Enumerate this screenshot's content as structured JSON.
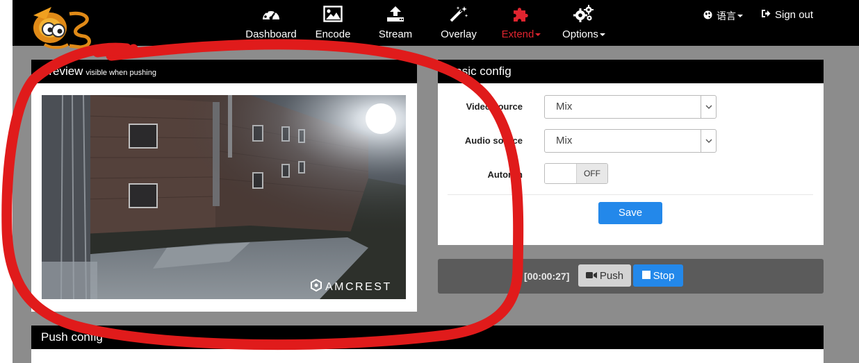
{
  "nav": [
    {
      "label": "Dashboard",
      "icon": "dashboard-icon"
    },
    {
      "label": "Encode",
      "icon": "image-icon"
    },
    {
      "label": "Stream",
      "icon": "upload-icon"
    },
    {
      "label": "Overlay",
      "icon": "magic-wand-icon"
    },
    {
      "label": "Extend",
      "icon": "puzzle-icon",
      "active": true,
      "dropdown": true
    },
    {
      "label": "Options",
      "icon": "gears-icon",
      "dropdown": true
    }
  ],
  "language": {
    "label": "语言",
    "icon": "globe-icon"
  },
  "signout": {
    "label": "Sign out",
    "icon": "signout-icon"
  },
  "preview": {
    "title": "Preview",
    "subtitle": "visible when pushing",
    "watermark": "AMCREST"
  },
  "basic_config": {
    "title": "Basic config",
    "video_source_label": "Video source",
    "video_source_value": "Mix",
    "audio_source_label": "Audio source",
    "audio_source_value": "Mix",
    "autorun_label": "Autorun",
    "autorun_state": "OFF",
    "save_label": "Save"
  },
  "control": {
    "timer": "[00:00:27]",
    "push_label": "Push",
    "stop_label": "Stop"
  },
  "push_config": {
    "title": "Push config"
  },
  "colors": {
    "accent": "#2388ea",
    "active_nav": "#e0242f",
    "annotation": "#e01b1b",
    "background": "#8c8c8c",
    "topbar": "#000000"
  }
}
